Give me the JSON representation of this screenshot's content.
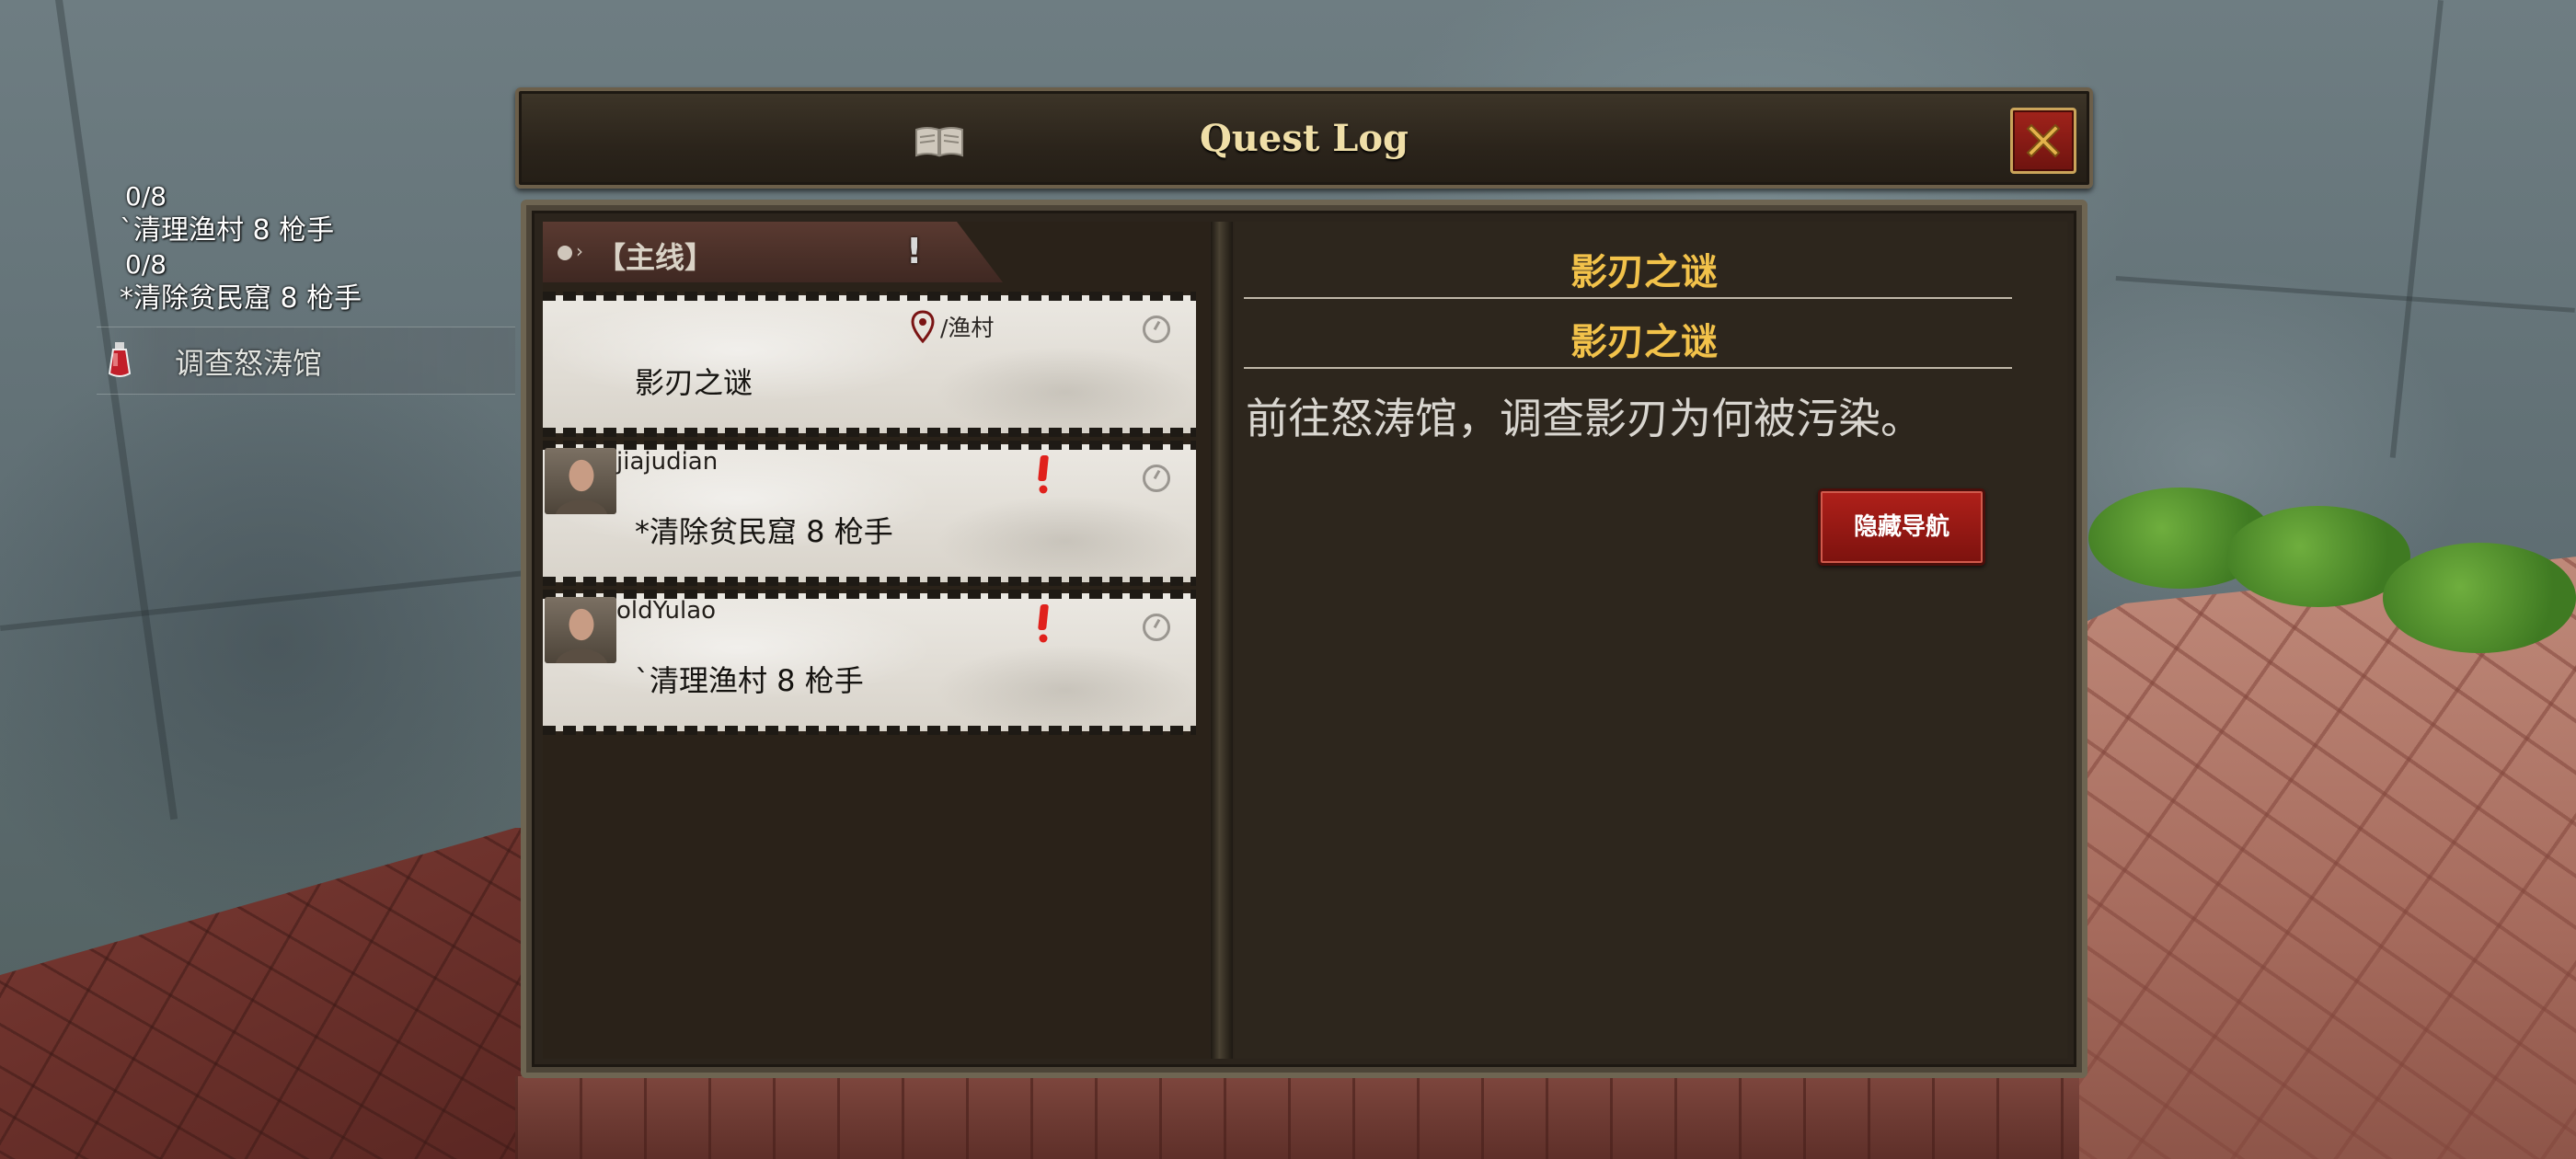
{
  "hud": {
    "lines": [
      {
        "text": "0/8",
        "kind": "count"
      },
      {
        "text": "`清理渔村 8 枪手",
        "kind": "quest"
      },
      {
        "text": "0/8",
        "kind": "count"
      },
      {
        "text": "*清除贫民窟 8 枪手",
        "kind": "quest"
      }
    ],
    "tracked_quest": "调查怒涛馆",
    "tracked_icon": "potion-flask-icon"
  },
  "window": {
    "title": "Quest Log",
    "title_icon": "book-icon",
    "close_icon": "close-x-icon"
  },
  "quest_list": {
    "category": "【主线】",
    "category_marker": "!",
    "quests": [
      {
        "location": "/渔村",
        "name": "影刃之谜",
        "giver": "",
        "selected": true
      },
      {
        "location": "",
        "name": "*清除贫民窟 8 枪手",
        "giver": "jiajudian",
        "alert": true
      },
      {
        "location": "",
        "name": "`清理渔村 8 枪手",
        "giver": "oldYulao",
        "alert": true
      }
    ]
  },
  "detail": {
    "title": "影刃之谜",
    "subtitle": "影刃之谜",
    "description": "前往怒涛馆，调查影刃为何被污染。",
    "nav_button": "隐藏导航"
  },
  "colors": {
    "title_gold": "#f2c24a",
    "button_red": "#b0201a",
    "alert_red": "#e0211c",
    "panel_brown": "#2d261d"
  }
}
